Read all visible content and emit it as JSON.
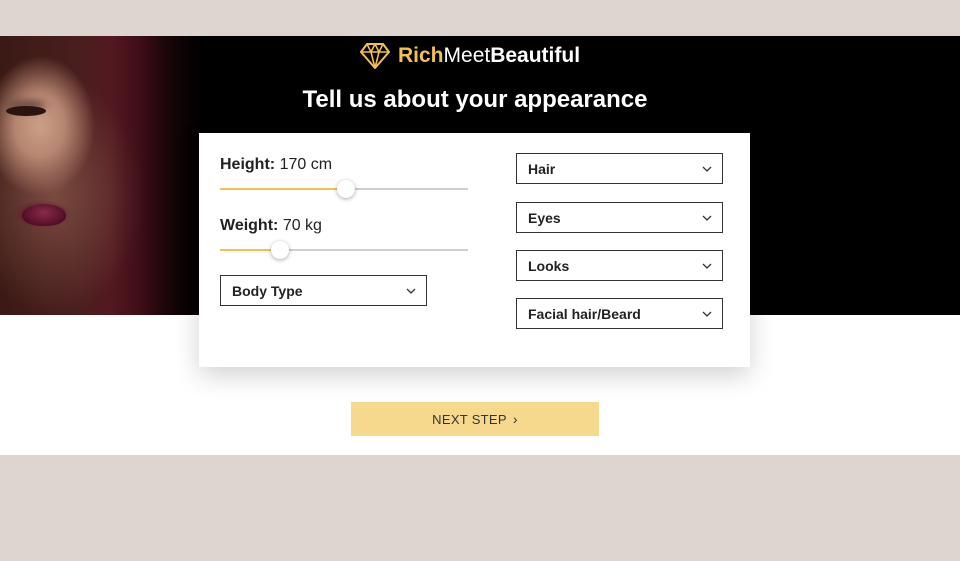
{
  "brand": {
    "part1": "Rich",
    "part2": "Meet",
    "part3": "Beautiful",
    "accent": "#f2c14e"
  },
  "headline": "Tell us about your appearance",
  "sliders": {
    "height": {
      "label": "Height:",
      "value": "170 cm",
      "fill_fraction": 0.51
    },
    "weight": {
      "label": "Weight:",
      "value": "70 kg",
      "fill_fraction": 0.24
    }
  },
  "selects": {
    "body_type": "Body Type",
    "hair": "Hair",
    "eyes": "Eyes",
    "looks": "Looks",
    "facial_hair": "Facial hair/Beard"
  },
  "next_button": {
    "label": "NEXT STEP",
    "arrow": "›"
  },
  "icons": {
    "logo": "diamond-icon",
    "dropdown": "chevron-down-icon"
  }
}
